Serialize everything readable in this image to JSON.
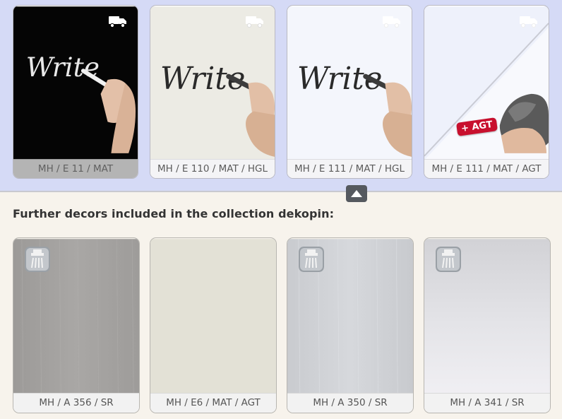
{
  "top_decors": [
    {
      "code": "MH / E 11 / MAT",
      "art_text": "Write"
    },
    {
      "code": "MH / E 110 / MAT / HGL",
      "art_text": "Write"
    },
    {
      "code": "MH / E 111 / MAT / HGL",
      "art_text": "Write"
    },
    {
      "code": "MH / E 111 / MAT / AGT",
      "badge": "+ AGT"
    }
  ],
  "section_title": "Further decors included in the collection dekopin:",
  "further_decors": [
    {
      "code": "MH / A 356 / SR"
    },
    {
      "code": "MH / E6 / MAT / AGT"
    },
    {
      "code": "MH / A 350 / SR"
    },
    {
      "code": "MH / A 341 / SR"
    }
  ],
  "colors": {
    "top_band": "#d5daf6",
    "page_bg": "#f7f3ec",
    "agt_badge": "#c8102e",
    "collapse_button": "#55595f"
  },
  "icons": {
    "delivery": "truck-icon",
    "collapse": "caret-up-icon",
    "feature": "shower-icon"
  }
}
